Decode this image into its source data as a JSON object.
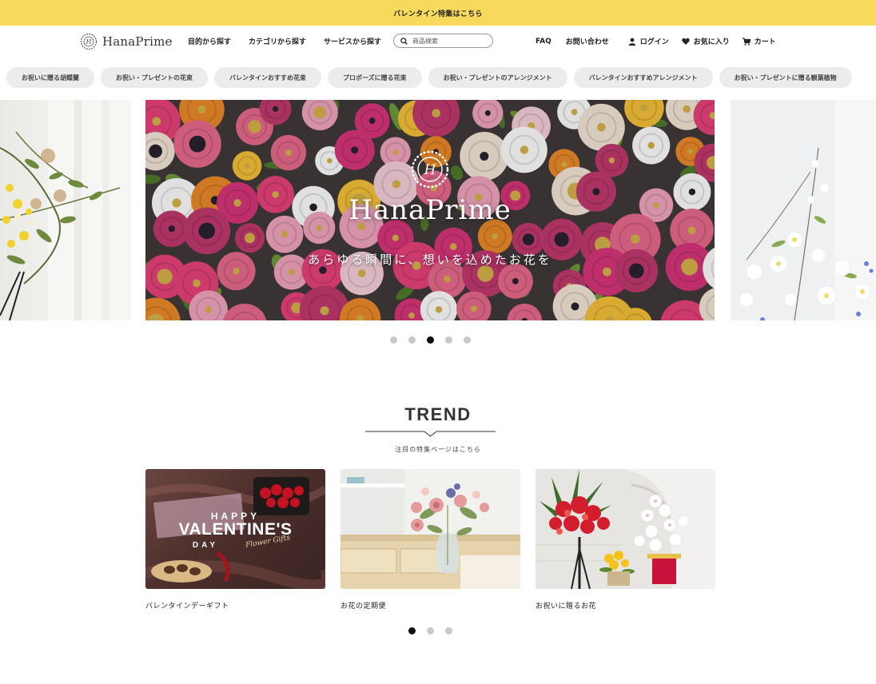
{
  "banner": {
    "text": "バレンタイン特集はこちら"
  },
  "header": {
    "logo_text": "HanaPrime",
    "nav": [
      "目的から探す",
      "カテゴリから探す",
      "サービスから探す"
    ],
    "search_placeholder": "商品検索",
    "utility": {
      "faq": "FAQ",
      "contact": "お問い合わせ",
      "login": "ログイン",
      "favorites": "お気に入り",
      "cart": "カート"
    }
  },
  "pills": [
    "お祝いに贈る胡蝶蘭",
    "お祝い・プレゼントの花束",
    "バレンタインおすすめ花束",
    "プロポーズに贈る花束",
    "お祝い・プレゼントのアレンジメント",
    "バレンタインおすすめアレンジメント",
    "お祝い・プレゼントに贈る観葉植物"
  ],
  "hero": {
    "title": "HanaPrime",
    "tagline": "あらゆる瞬間に、想いを込めたお花を",
    "slide_count": 5,
    "active_slide": 3
  },
  "trend": {
    "title": "TREND",
    "subtitle": "注目の特集ページはこちら",
    "cards": [
      {
        "label": "バレンタインデーギフト",
        "image_text": {
          "happy": "HAPPY",
          "main": "VALENTINE'S",
          "day": "DAY",
          "script": "Flower Gifts"
        }
      },
      {
        "label": "お花の定期便"
      },
      {
        "label": "お祝いに贈るお花"
      }
    ],
    "page_count": 3,
    "active_page": 1
  },
  "colors": {
    "banner": "#f7d95c",
    "pill_bg": "#ececec",
    "dot_active": "#111111",
    "dot_inactive": "#c9c9c9"
  }
}
